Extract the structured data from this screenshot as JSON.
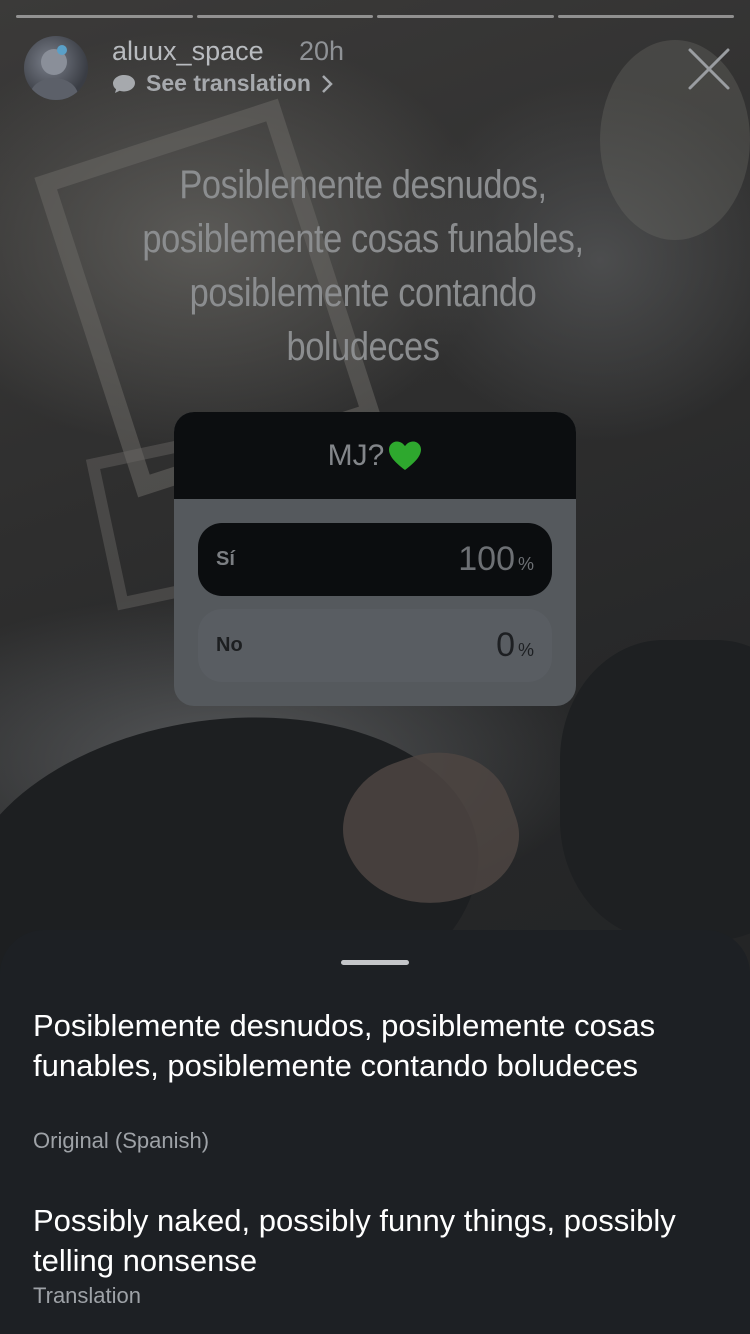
{
  "story": {
    "progress_segments": 4,
    "user": {
      "username": "aluux_space",
      "time": "20h",
      "see_translation": "See translation",
      "icons": {
        "translate": "speech-bubble-icon",
        "chevron": "chevron-right-icon",
        "close": "close-icon"
      }
    },
    "text_lines": [
      "Posiblemente desnudos,",
      "posiblemente cosas funables,",
      "posiblemente contando",
      "boludeces"
    ]
  },
  "poll": {
    "question": "MJ?",
    "question_icon": "green-heart-icon",
    "options": [
      {
        "label": "Sí",
        "percent": "100",
        "sign": "%"
      },
      {
        "label": "No",
        "percent": "0",
        "sign": "%"
      }
    ],
    "colors": {
      "heart": "#2ea82e"
    }
  },
  "translation_sheet": {
    "original_text": "Posiblemente desnudos, posiblemente cosas funables, posiblemente contando boludeces",
    "original_caption": "Original (Spanish)",
    "translated_text": "Possibly naked, possibly funny things, possibly telling nonsense",
    "translated_caption": "Translation"
  }
}
